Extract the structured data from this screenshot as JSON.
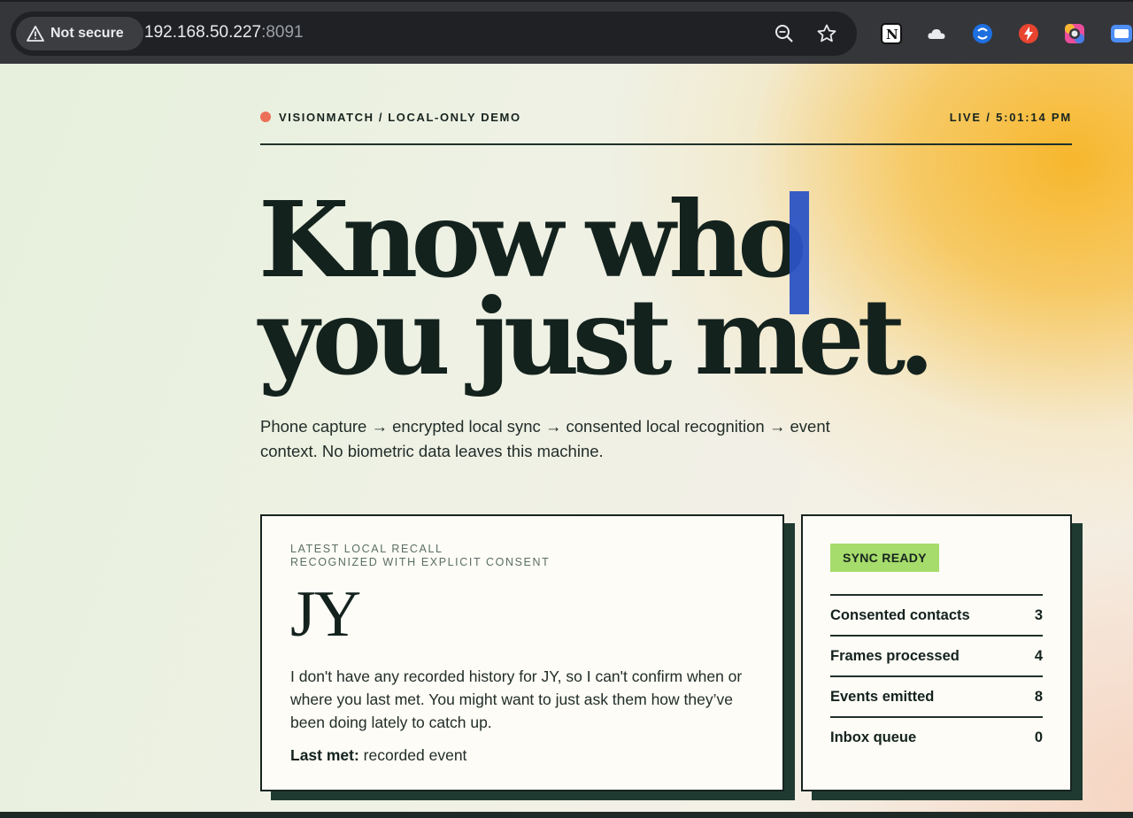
{
  "browser": {
    "security_label": "Not secure",
    "url_host": "192.168.50.227",
    "url_port": ":8091",
    "icons": [
      "warning-icon",
      "zoom-icon",
      "star-icon",
      "notion-icon",
      "cloud-icon",
      "sync-extension-icon",
      "bolt-extension-icon",
      "color-picker-icon",
      "screen-extension-icon"
    ]
  },
  "header": {
    "brand": "VISIONMATCH / LOCAL-ONLY DEMO",
    "live": "LIVE / 5:01:14 PM",
    "accent": "#ec6f58"
  },
  "hero": {
    "line1": "Know who",
    "line2": "you just met.",
    "subtitle": "Phone capture → encrypted local sync → consented local recognition → event context. No biometric data leaves this machine."
  },
  "recall": {
    "eyebrow1": "LATEST LOCAL RECALL",
    "eyebrow2": "RECOGNIZED WITH EXPLICIT CONSENT",
    "initials": "JY",
    "message": "I don't have any recorded history for JY, so I can't confirm when or where you last met. You might want to just ask them how they’ve been doing lately to catch up.",
    "last_met_label": "Last met:",
    "last_met_value": "recorded event"
  },
  "stats": {
    "badge": "SYNC READY",
    "badge_color": "#a6dc6b",
    "rows": [
      {
        "label": "Consented contacts",
        "value": "3"
      },
      {
        "label": "Frames processed",
        "value": "4"
      },
      {
        "label": "Events emitted",
        "value": "8"
      },
      {
        "label": "Inbox queue",
        "value": "0"
      }
    ]
  }
}
